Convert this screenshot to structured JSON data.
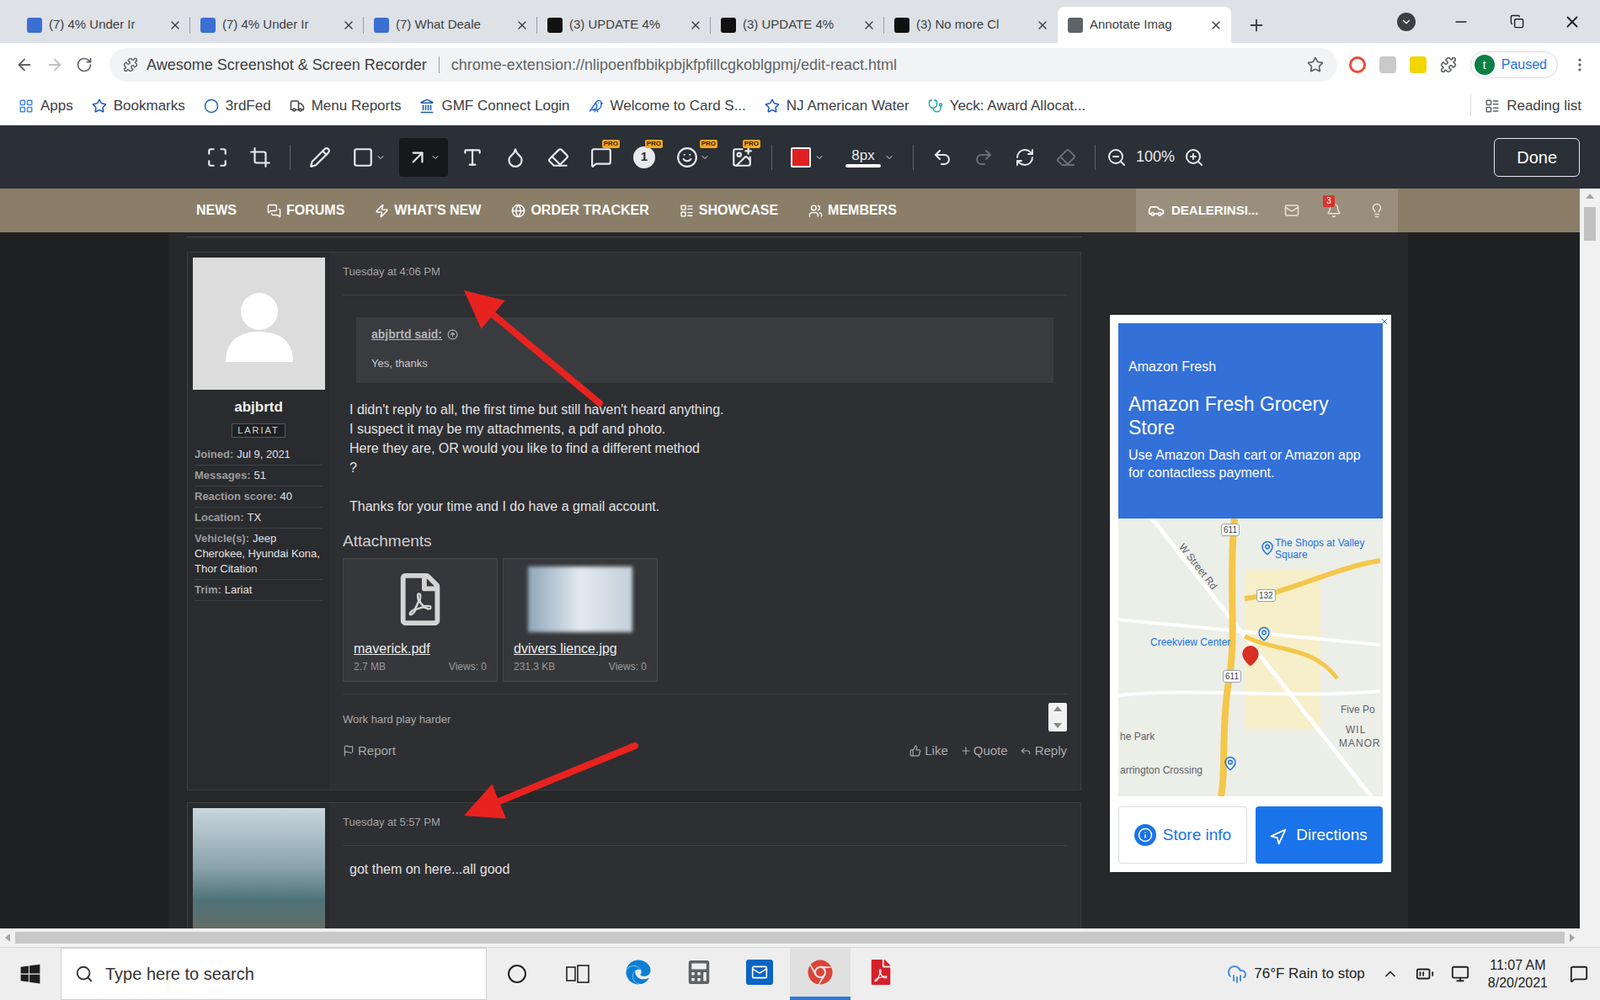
{
  "browser": {
    "tabs": [
      {
        "title": "(7) 4% Under Ir",
        "selected": false,
        "color": "#3b6fd4"
      },
      {
        "title": "(7) 4% Under Ir",
        "selected": false,
        "color": "#3b6fd4"
      },
      {
        "title": "(7) What Deale",
        "selected": false,
        "color": "#3b6fd4"
      },
      {
        "title": "(3) UPDATE 4%",
        "selected": false,
        "color": "#111111"
      },
      {
        "title": "(3) UPDATE 4%",
        "selected": false,
        "color": "#111111"
      },
      {
        "title": "(3) No more Cl",
        "selected": false,
        "color": "#111111"
      },
      {
        "title": "Annotate Imag",
        "selected": true,
        "color": "#5f6368"
      }
    ],
    "address": {
      "site": "Awesome Screenshot & Screen Recorder",
      "url": "chrome-extension://nlipoenfbbikpbjkfpfillcgkoblgpmj/edit-react.html"
    },
    "profile": {
      "initial": "t",
      "status": "Paused"
    },
    "bookmarks": [
      {
        "label": "Apps",
        "color": "#4285f4"
      },
      {
        "label": "Bookmarks",
        "color": "#1a56c4"
      },
      {
        "label": "3rdFed",
        "color": "#1f5fbf"
      },
      {
        "label": "Menu Reports",
        "color": "#444444"
      },
      {
        "label": "GMF Connect Login",
        "color": "#1e5aa8"
      },
      {
        "label": "Welcome to Card S...",
        "color": "#2a6fd6"
      },
      {
        "label": "NJ American Water",
        "color": "#1a56c4"
      },
      {
        "label": "Yeck: Award Allocat...",
        "color": "#2aa3b0"
      }
    ],
    "reading_list": "Reading list"
  },
  "editor": {
    "tools": [
      {
        "selected": false
      },
      {
        "selected": false
      },
      {
        "selected": false
      },
      {
        "selected": false
      },
      {
        "selected": true
      },
      {
        "selected": false
      },
      {
        "selected": false
      },
      {
        "selected": false
      }
    ],
    "pro_tools": [
      {
        "badge": "PRO"
      },
      {
        "badge": "PRO",
        "step": "1"
      },
      {
        "badge": "PRO"
      },
      {
        "badge": "PRO"
      }
    ],
    "color": "#e02020",
    "stroke": "8px",
    "history": [
      {
        "disabled": false
      },
      {
        "disabled": true
      },
      {
        "disabled": false
      },
      {
        "disabled": true
      }
    ],
    "zoom": "100%",
    "done": "Done"
  },
  "forum_nav": {
    "items": [
      {
        "label": "NEWS"
      },
      {
        "label": "FORUMS"
      },
      {
        "label": "WHAT'S NEW"
      },
      {
        "label": "ORDER TRACKER"
      },
      {
        "label": "SHOWCASE"
      },
      {
        "label": "MEMBERS"
      }
    ],
    "account": "DEALERINSI...",
    "alerts": "3"
  },
  "posts": [
    {
      "avatar": "placeholder",
      "author": "abjbrtd",
      "rank": "LARIAT",
      "stats": [
        {
          "label": "Joined:",
          "value": "Jul 9, 2021"
        },
        {
          "label": "Messages:",
          "value": "51"
        },
        {
          "label": "Reaction score:",
          "value": "40"
        },
        {
          "label": "Location:",
          "value": "TX"
        },
        {
          "label": "Vehicle(s):",
          "value": "Jeep Cherokee, Hyundai Kona, Thor Citation"
        },
        {
          "label": "Trim:",
          "value": "Lariat"
        }
      ],
      "time": "Tuesday at 4:06 PM",
      "quote": {
        "author": "abjbrtd said:",
        "text": "Yes, thanks"
      },
      "paragraphs": [
        [
          "I didn't reply to all, the first time but still haven't heard anything.",
          "I suspect it may be my attachments, a pdf and photo.",
          "Here they are, OR would you like to find a different method",
          "?"
        ],
        [
          "Thanks for your time and I do have a gmail account."
        ]
      ],
      "attachments_title": "Attachments",
      "attachments": [
        {
          "kind": "pdf",
          "name": "maverick.pdf",
          "size": "2.7 MB",
          "views": "Views: 0"
        },
        {
          "kind": "image",
          "name": "dvivers lience.jpg",
          "size": "231.3 KB",
          "views": "Views: 0"
        }
      ],
      "signature": "Work hard play harder",
      "actions": {
        "report": "Report",
        "like": "Like",
        "quote": "Quote",
        "reply": "Reply"
      }
    },
    {
      "avatar": "photo",
      "time": "Tuesday at 5:57 PM",
      "paragraphs": [
        [
          "got them on here...all good"
        ]
      ]
    }
  ],
  "ad": {
    "brand": "Amazon Fresh",
    "title": "Amazon Fresh Grocery Store",
    "text": "Use Amazon Dash cart or Amazon app for contactless payment.",
    "map": {
      "shields": [
        "611",
        "132",
        "611"
      ],
      "places": [
        "The Shops at Valley Square",
        "W Street Rd",
        "Creekview Center",
        "Five Po",
        "WIL",
        "MANOR",
        "he Park",
        "arrington Crossing"
      ]
    },
    "buttons": {
      "info": "Store info",
      "directions": "Directions"
    }
  },
  "annotations": [
    {
      "kind": "arrow",
      "color": "#e8231f"
    },
    {
      "kind": "arrow",
      "color": "#e8231f"
    }
  ],
  "taskbar": {
    "search_placeholder": "Type here to search",
    "apps": [
      {
        "active": false
      },
      {
        "active": false
      },
      {
        "active": false
      },
      {
        "active": true
      },
      {
        "active": false
      }
    ],
    "weather": "76°F Rain to stop",
    "time": "11:07 AM",
    "date": "8/20/2021"
  }
}
